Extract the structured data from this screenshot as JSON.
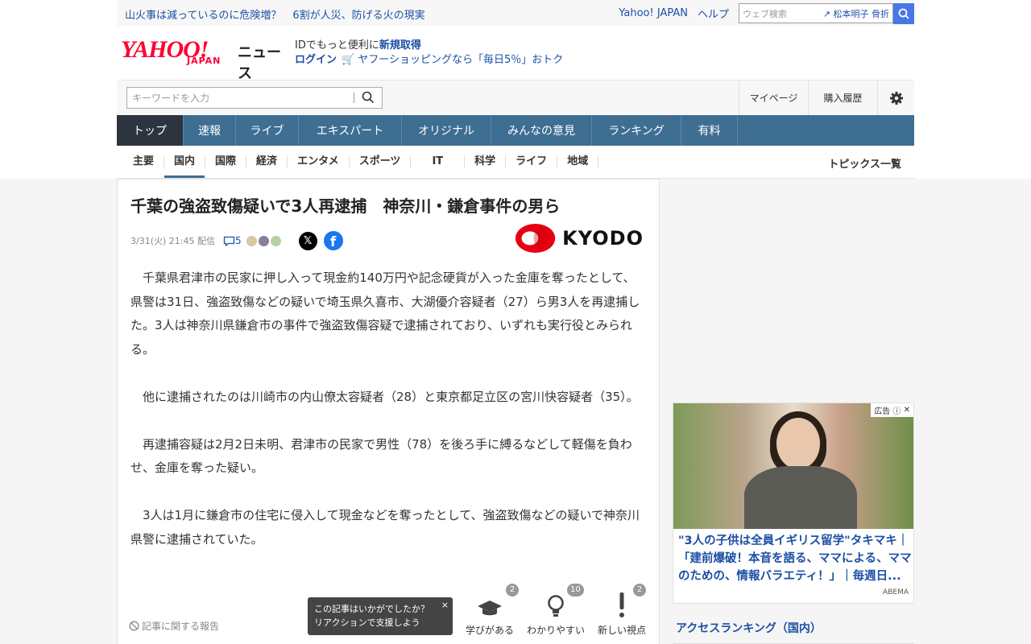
{
  "topbar": {
    "headline1": "山火事は減っているのに危険増？",
    "headline2": "6割が人災、防げる火の現実",
    "yahoo_japan": "Yahoo! JAPAN",
    "help": "ヘルプ",
    "web_search_placeholder": "ウェブ検索",
    "trend_keyword": "松本明子 骨折"
  },
  "header": {
    "logo_text": "YAHOO!",
    "logo_sub": "JAPAN",
    "section": "ニュース",
    "id_promo_prefix": "IDでもっと便利に",
    "id_promo_link": "新規取得",
    "login": "ログイン",
    "shopping_promo": "ヤフーショッピングなら「毎日5％」おトク"
  },
  "search": {
    "placeholder": "キーワードを入力",
    "mypage": "マイページ",
    "history": "購入履歴"
  },
  "mainnav": [
    {
      "label": "トップ"
    },
    {
      "label": "速報"
    },
    {
      "label": "ライブ"
    },
    {
      "label": "エキスパート"
    },
    {
      "label": "オリジナル"
    },
    {
      "label": "みんなの意見"
    },
    {
      "label": "ランキング"
    },
    {
      "label": "有料"
    }
  ],
  "subnav": [
    {
      "label": "主要"
    },
    {
      "label": "国内"
    },
    {
      "label": "国際"
    },
    {
      "label": "経済"
    },
    {
      "label": "エンタメ"
    },
    {
      "label": "スポーツ"
    },
    {
      "label": "IT"
    },
    {
      "label": "科学"
    },
    {
      "label": "ライフ"
    },
    {
      "label": "地域"
    }
  ],
  "topics_link": "トピックス一覧",
  "article": {
    "title": "千葉の強盗致傷疑いで3人再逮捕　神奈川・鎌倉事件の男ら",
    "date": "3/31(火) 21:45",
    "distribution": "配信",
    "comments": "5",
    "publisher": "KYODO",
    "share_x": "𝕏",
    "share_facebook": "f",
    "paragraphs": [
      "千葉県君津市の民家に押し入って現金約140万円や記念硬貨が入った金庫を奪ったとして、県警は31日、強盗致傷などの疑いで埼玉県久喜市、大湖優介容疑者（27）ら男3人を再逮捕した。3人は神奈川県鎌倉市の事件で強盗致傷容疑で逮捕されており、いずれも実行役とみられる。",
      "他に逮捕されたのは川崎市の内山僚太容疑者（28）と東京都足立区の宮川快容疑者（35）。",
      "再逮捕容疑は2月2日未明、君津市の民家で男性（78）を後ろ手に縛るなどして軽傷を負わせ、金庫を奪った疑い。",
      "3人は1月に鎌倉市の住宅に侵入して現金などを奪ったとして、強盗致傷などの疑いで神奈川県警に逮捕されていた。"
    ],
    "report": "記事に関する報告"
  },
  "reaction_toast": {
    "line1": "この記事はいかがでしたか？",
    "line2": "リアクションで支援しよう",
    "close": "×"
  },
  "reactions": [
    {
      "label": "学びがある",
      "count": "2",
      "icon": "graduation-cap-icon"
    },
    {
      "label": "わかりやすい",
      "count": "10",
      "icon": "lightbulb-icon"
    },
    {
      "label": "新しい視点",
      "count": "2",
      "icon": "exclamation-icon"
    }
  ],
  "ad": {
    "tag": "広告",
    "text": "\"3人の子供は全員イギリス留学\"タキマキ｜「建前爆破！本音を語る、ママによる、ママのための、情報バラエティ！」｜毎週日...",
    "source": "ABEMA"
  },
  "ranking_title": "アクセスランキング（国内）",
  "colors": {
    "nav": "#3f6e93",
    "nav_active": "#2c3440",
    "link": "#1c4fa5",
    "brand_red": "#ff0033"
  }
}
